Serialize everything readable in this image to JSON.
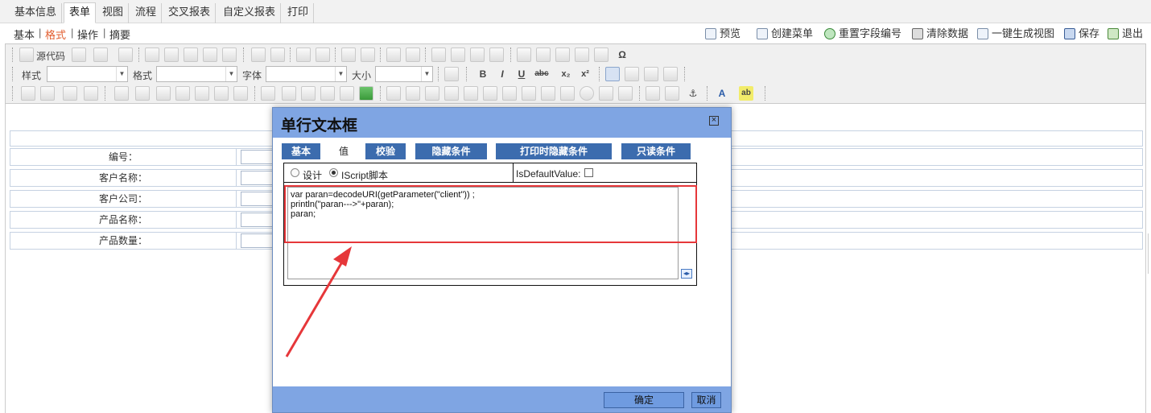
{
  "top_tabs": [
    "基本信息",
    "表单",
    "视图",
    "流程",
    "交叉报表",
    "自定义报表",
    "打印"
  ],
  "active_top_tab": "表单",
  "sub_tabs": [
    "基本",
    "格式",
    "操作",
    "摘要"
  ],
  "active_sub_tab": "格式",
  "actions": [
    {
      "label": "预览",
      "icon": "preview-icon"
    },
    {
      "label": "创建菜单",
      "icon": "create-menu-icon"
    },
    {
      "label": "重置字段编号",
      "icon": "refresh-icon"
    },
    {
      "label": "清除数据",
      "icon": "trash-icon"
    },
    {
      "label": "一键生成视图",
      "icon": "generate-view-icon"
    },
    {
      "label": "保存",
      "icon": "save-icon"
    },
    {
      "label": "退出",
      "icon": "exit-icon"
    }
  ],
  "toolbar": {
    "source_label": "源代码",
    "style_label": "样式",
    "format_label": "格式",
    "font_label": "字体",
    "size_label": "大小"
  },
  "form_rows": [
    "编号：",
    "客户名称：",
    "客户公司：",
    "产品名称：",
    "产品数量："
  ],
  "dialog": {
    "title": "单行文本框",
    "close_glyph": "×",
    "tabs": [
      "基本",
      "值",
      "校验",
      "隐藏条件",
      "打印时隐藏条件",
      "只读条件"
    ],
    "active_tab": "值",
    "radio_design": "设计",
    "radio_script": "IScript脚本",
    "is_default_label": "IsDefaultValue:",
    "code": "var paran=decodeURI(getParameter(\"client\")) ;\nprintln(\"paran--->\"+paran);\nparan;",
    "ok_label": "确定",
    "cancel_label": "取消"
  },
  "colors": {
    "accent_orange": "#e25c2d",
    "dialog_blue": "#7fa5e3",
    "tab_blue": "#3c6cae",
    "highlight_red": "#e6373a"
  }
}
